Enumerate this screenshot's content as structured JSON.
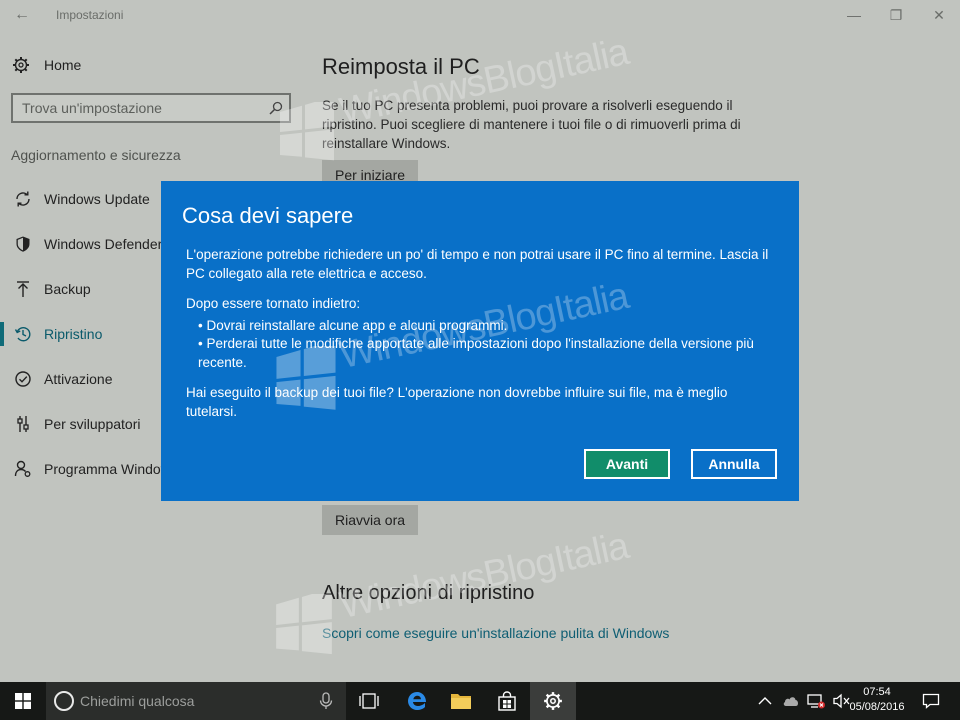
{
  "window": {
    "title": "Impostazioni"
  },
  "sidebar": {
    "home_label": "Home",
    "search_placeholder": "Trova un'impostazione",
    "section_label": "Aggiornamento e sicurezza",
    "items": [
      {
        "label": "Windows Update",
        "icon": "sync-icon"
      },
      {
        "label": "Windows Defender",
        "icon": "shield-icon"
      },
      {
        "label": "Backup",
        "icon": "upload-arrow-icon"
      },
      {
        "label": "Ripristino",
        "icon": "history-icon",
        "active": true
      },
      {
        "label": "Attivazione",
        "icon": "check-circle-icon"
      },
      {
        "label": "Per sviluppatori",
        "icon": "sliders-icon"
      },
      {
        "label": "Programma Windows Insider",
        "icon": "person-icon"
      }
    ]
  },
  "main": {
    "reset_title": "Reimposta il PC",
    "reset_text": "Se il tuo PC presenta problemi, puoi provare a risolverli eseguendo il ripristino. Puoi scegliere di mantenere i tuoi file o di rimuoverli prima di reinstallare Windows.",
    "start_button": "Per iniziare",
    "restart_button": "Riavvia ora",
    "more_title": "Altre opzioni di ripristino",
    "clean_install_link": "Scopri come eseguire un'installazione pulita di Windows"
  },
  "dialog": {
    "title": "Cosa devi sapere",
    "para1": "L'operazione potrebbe richiedere un po' di tempo e non potrai usare il PC fino al termine. Lascia il PC collegato alla rete elettrica e acceso.",
    "para2_intro": "Dopo essere tornato indietro:",
    "bullet1": "• Dovrai reinstallare alcune app e alcuni programmi.",
    "bullet2": "• Perderai tutte le modifiche apportate alle impostazioni dopo l'installazione della versione più recente.",
    "para3": "Hai eseguito il backup dei tuoi file? L'operazione non dovrebbe influire sui file, ma è meglio tutelarsi.",
    "ok_button": "Avanti",
    "cancel_button": "Annulla"
  },
  "watermark": {
    "text": "WindowsBlogItalia"
  },
  "taskbar": {
    "search_placeholder": "Chiedimi qualcosa",
    "time": "07:54",
    "date": "05/08/2016"
  },
  "colors": {
    "dialog_bg": "#0970c8",
    "primary_button": "#118d6a",
    "accent": "#0f6b78",
    "taskbar": "#161816"
  }
}
